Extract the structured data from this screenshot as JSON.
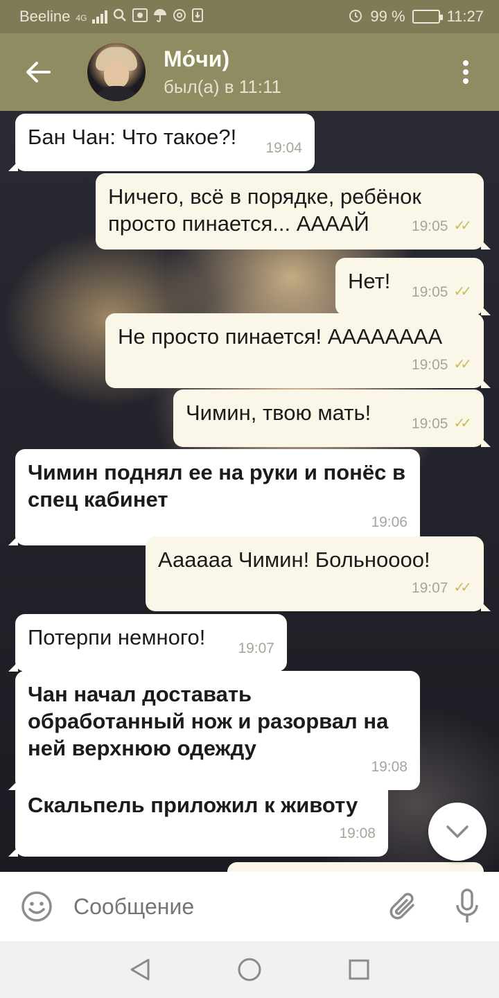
{
  "status_bar": {
    "carrier": "Beeline",
    "network": "4G",
    "battery": "99 %",
    "battery_level": 0.99,
    "time": "11:27",
    "icons": [
      "signal-icon",
      "search-icon",
      "gallery-icon",
      "umbrella-icon",
      "at-icon",
      "download-icon",
      "alarm-icon",
      "battery-icon"
    ]
  },
  "header": {
    "contact_name": "Мо́чи)",
    "last_seen": "был(а) в 11:11",
    "icons": [
      "back-arrow-icon",
      "avatar",
      "more-vertical-icon"
    ]
  },
  "messages": [
    {
      "direction": "in",
      "text": "Бан Чан: Что такое?!",
      "time": "19:04",
      "bold": false
    },
    {
      "direction": "out",
      "text": "Ничего, всё в порядке, ребёнок просто пинается... ААААЙ",
      "time": "19:05",
      "read": true,
      "bold": false
    },
    {
      "direction": "out",
      "text": "Нет!",
      "time": "19:05",
      "read": true,
      "bold": false
    },
    {
      "direction": "out",
      "text": "Не просто пинается! АААААААА",
      "time": "19:05",
      "read": true,
      "bold": false
    },
    {
      "direction": "out",
      "text": "Чимин, твою мать!",
      "time": "19:05",
      "read": true,
      "bold": false
    },
    {
      "direction": "in",
      "text": "Чимин поднял ее на руки и понёс в спец кабинет",
      "time": "19:06",
      "bold": true
    },
    {
      "direction": "out",
      "text": "Аааааа Чимин! Больноооо!",
      "time": "19:07",
      "read": true,
      "bold": false
    },
    {
      "direction": "in",
      "text": "Потерпи немного!",
      "time": "19:07",
      "bold": false
    },
    {
      "direction": "in",
      "text": "Чан начал доставать обработанный нож и разорвал на ней верхнюю одежду",
      "time": "19:08",
      "bold": true
    },
    {
      "direction": "in",
      "text": "Скальпель приложил к животу",
      "time": "19:08",
      "bold": true
    }
  ],
  "input": {
    "placeholder": "Сообщение",
    "icons": [
      "emoji-icon",
      "attach-icon",
      "mic-icon"
    ]
  },
  "colors": {
    "status_bar": "#7e7b56",
    "header": "#8f8c61",
    "bubble_in": "#ffffff",
    "bubble_out": "#fbf7e8",
    "read_ticks": "#c7bb5a"
  }
}
